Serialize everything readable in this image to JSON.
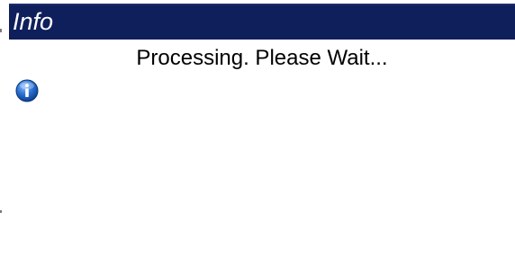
{
  "window": {
    "title": "Info"
  },
  "dialog": {
    "message": "Processing.  Please Wait...",
    "icon": "info-icon"
  },
  "colors": {
    "titlebar_bg": "#0f1f5c",
    "title_text": "#ffffff",
    "dialog_bg": "#ffffff",
    "icon_blue": "#1f5fb8"
  }
}
